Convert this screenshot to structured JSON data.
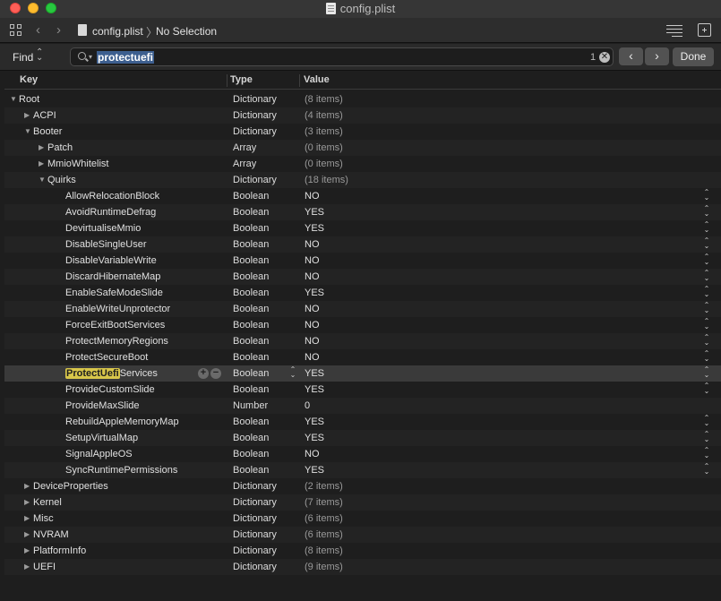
{
  "window": {
    "title": "config.plist"
  },
  "toolbar": {
    "breadcrumb_file": "config.plist",
    "breadcrumb_sep": "〉",
    "breadcrumb_selection": "No Selection"
  },
  "find": {
    "label": "Find",
    "query": "protectuefi",
    "match_count": "1",
    "done_label": "Done"
  },
  "columns": {
    "key": "Key",
    "type": "Type",
    "value": "Value"
  },
  "rows": [
    {
      "depth": 0,
      "disclosure": "open",
      "key": "Root",
      "type": "Dictionary",
      "value": "(8 items)",
      "dim": true
    },
    {
      "depth": 1,
      "disclosure": "closed",
      "key": "ACPI",
      "type": "Dictionary",
      "value": "(4 items)",
      "dim": true
    },
    {
      "depth": 1,
      "disclosure": "open",
      "key": "Booter",
      "type": "Dictionary",
      "value": "(3 items)",
      "dim": true
    },
    {
      "depth": 2,
      "disclosure": "closed",
      "key": "Patch",
      "type": "Array",
      "value": "(0 items)",
      "dim": true
    },
    {
      "depth": 2,
      "disclosure": "closed",
      "key": "MmioWhitelist",
      "type": "Array",
      "value": "(0 items)",
      "dim": true
    },
    {
      "depth": 2,
      "disclosure": "open",
      "key": "Quirks",
      "type": "Dictionary",
      "value": "(18 items)",
      "dim": true
    },
    {
      "depth": 3,
      "key": "AllowRelocationBlock",
      "type": "Boolean",
      "value": "NO",
      "stepper": true
    },
    {
      "depth": 3,
      "key": "AvoidRuntimeDefrag",
      "type": "Boolean",
      "value": "YES",
      "stepper": true
    },
    {
      "depth": 3,
      "key": "DevirtualiseMmio",
      "type": "Boolean",
      "value": "YES",
      "stepper": true
    },
    {
      "depth": 3,
      "key": "DisableSingleUser",
      "type": "Boolean",
      "value": "NO",
      "stepper": true
    },
    {
      "depth": 3,
      "key": "DisableVariableWrite",
      "type": "Boolean",
      "value": "NO",
      "stepper": true
    },
    {
      "depth": 3,
      "key": "DiscardHibernateMap",
      "type": "Boolean",
      "value": "NO",
      "stepper": true
    },
    {
      "depth": 3,
      "key": "EnableSafeModeSlide",
      "type": "Boolean",
      "value": "YES",
      "stepper": true
    },
    {
      "depth": 3,
      "key": "EnableWriteUnprotector",
      "type": "Boolean",
      "value": "NO",
      "stepper": true
    },
    {
      "depth": 3,
      "key": "ForceExitBootServices",
      "type": "Boolean",
      "value": "NO",
      "stepper": true
    },
    {
      "depth": 3,
      "key": "ProtectMemoryRegions",
      "type": "Boolean",
      "value": "NO",
      "stepper": true
    },
    {
      "depth": 3,
      "key": "ProtectSecureBoot",
      "type": "Boolean",
      "value": "NO",
      "stepper": true
    },
    {
      "depth": 3,
      "key": "ProtectUefiServices",
      "match": "ProtectUefi",
      "rest": "Services",
      "type": "Boolean",
      "value": "YES",
      "stepper": true,
      "selected": true
    },
    {
      "depth": 3,
      "key": "ProvideCustomSlide",
      "type": "Boolean",
      "value": "YES",
      "stepper": true
    },
    {
      "depth": 3,
      "key": "ProvideMaxSlide",
      "type": "Number",
      "value": "0"
    },
    {
      "depth": 3,
      "key": "RebuildAppleMemoryMap",
      "type": "Boolean",
      "value": "YES",
      "stepper": true
    },
    {
      "depth": 3,
      "key": "SetupVirtualMap",
      "type": "Boolean",
      "value": "YES",
      "stepper": true
    },
    {
      "depth": 3,
      "key": "SignalAppleOS",
      "type": "Boolean",
      "value": "NO",
      "stepper": true
    },
    {
      "depth": 3,
      "key": "SyncRuntimePermissions",
      "type": "Boolean",
      "value": "YES",
      "stepper": true
    },
    {
      "depth": 1,
      "disclosure": "closed",
      "key": "DeviceProperties",
      "type": "Dictionary",
      "value": "(2 items)",
      "dim": true
    },
    {
      "depth": 1,
      "disclosure": "closed",
      "key": "Kernel",
      "type": "Dictionary",
      "value": "(7 items)",
      "dim": true
    },
    {
      "depth": 1,
      "disclosure": "closed",
      "key": "Misc",
      "type": "Dictionary",
      "value": "(6 items)",
      "dim": true
    },
    {
      "depth": 1,
      "disclosure": "closed",
      "key": "NVRAM",
      "type": "Dictionary",
      "value": "(6 items)",
      "dim": true
    },
    {
      "depth": 1,
      "disclosure": "closed",
      "key": "PlatformInfo",
      "type": "Dictionary",
      "value": "(8 items)",
      "dim": true
    },
    {
      "depth": 1,
      "disclosure": "closed",
      "key": "UEFI",
      "type": "Dictionary",
      "value": "(9 items)",
      "dim": true
    }
  ]
}
